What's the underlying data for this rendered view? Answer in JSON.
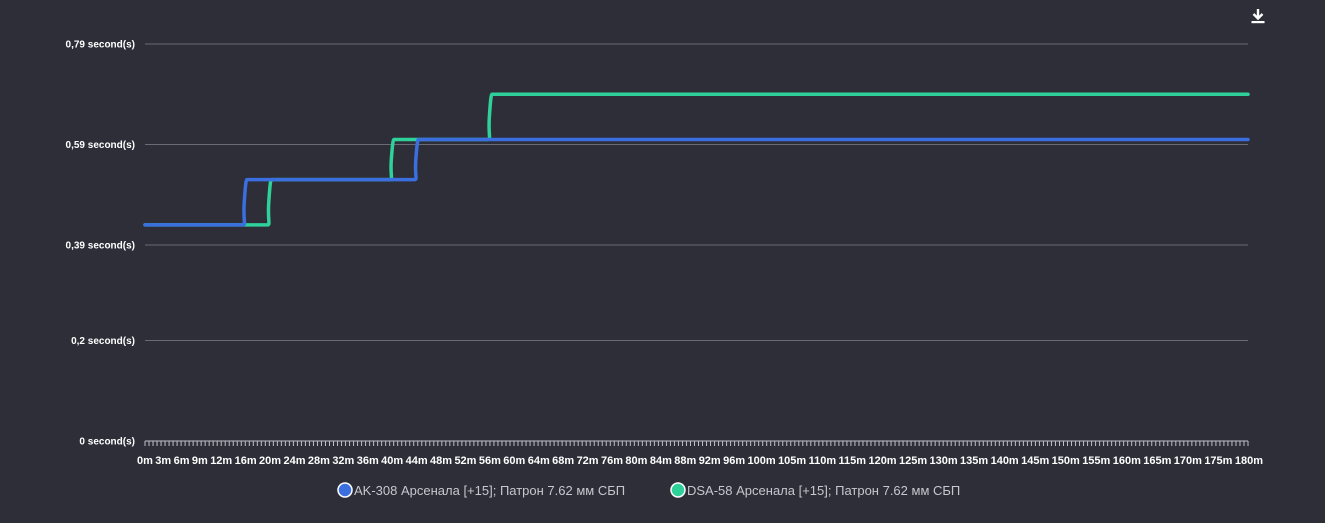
{
  "chart_data": {
    "type": "line",
    "interpolation": "step-after",
    "xlabel": "",
    "ylabel": "",
    "y_ticks": [
      "0 second(s)",
      "0,2 second(s)",
      "0,39 second(s)",
      "0,59 second(s)",
      "0,79 second(s)"
    ],
    "y_tick_values": [
      0,
      0.2,
      0.39,
      0.59,
      0.79
    ],
    "ylim": [
      0,
      0.79
    ],
    "x_ticks": [
      "0m",
      "3m",
      "6m",
      "9m",
      "12m",
      "16m",
      "20m",
      "24m",
      "28m",
      "32m",
      "36m",
      "40m",
      "44m",
      "48m",
      "52m",
      "56m",
      "60m",
      "64m",
      "68m",
      "72m",
      "76m",
      "80m",
      "84m",
      "88m",
      "92m",
      "96m",
      "100m",
      "105m",
      "110m",
      "115m",
      "120m",
      "125m",
      "130m",
      "135m",
      "140m",
      "145m",
      "150m",
      "155m",
      "160m",
      "165m",
      "170m",
      "175m",
      "180m"
    ],
    "x_tick_values": [
      0,
      3,
      6,
      9,
      12,
      16,
      20,
      24,
      28,
      32,
      36,
      40,
      44,
      48,
      52,
      56,
      60,
      64,
      68,
      72,
      76,
      80,
      84,
      88,
      92,
      96,
      100,
      105,
      110,
      115,
      120,
      125,
      130,
      135,
      140,
      145,
      150,
      155,
      160,
      165,
      170,
      175,
      180
    ],
    "grid": true,
    "legend": "bottom",
    "series": [
      {
        "name": "AK-308 Арсенала [+15]; Патрон 7.62 мм СБП",
        "color": "#3b6fe0",
        "points": [
          [
            0,
            0.43
          ],
          [
            16,
            0.43
          ],
          [
            16,
            0.52
          ],
          [
            44,
            0.52
          ],
          [
            44,
            0.6
          ],
          [
            180,
            0.6
          ]
        ]
      },
      {
        "name": "DSA-58 Арсенала [+15]; Патрон 7.62 мм СБП",
        "color": "#2fd19a",
        "points": [
          [
            0,
            0.43
          ],
          [
            20,
            0.43
          ],
          [
            20,
            0.52
          ],
          [
            40,
            0.52
          ],
          [
            40,
            0.6
          ],
          [
            56,
            0.6
          ],
          [
            56,
            0.69
          ],
          [
            180,
            0.69
          ]
        ]
      }
    ]
  },
  "toolbar": {
    "download_icon": "download-icon"
  }
}
